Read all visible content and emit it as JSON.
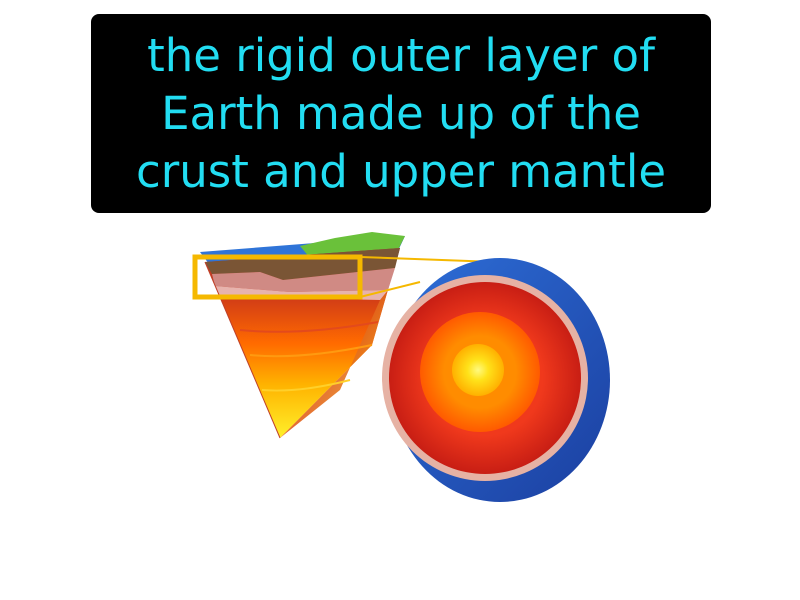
{
  "caption": {
    "lines": [
      "the rigid outer layer of",
      "Earth made up of the",
      "crust and upper mantle"
    ]
  },
  "illustration": {
    "icons": [
      "earth-layers-wedge-icon",
      "earth-cross-section-icon",
      "highlight-box-icon"
    ],
    "colors": {
      "caption_bg": "#000000",
      "caption_text": "#22ddf2",
      "highlight": "#f5b800",
      "ocean": "#2a6fd6",
      "crust": "#7a5535",
      "mantle": "#cc2a1a",
      "outer_core": "#ff7b00",
      "inner_core": "#ffee33",
      "land": "#6ac13a"
    }
  }
}
